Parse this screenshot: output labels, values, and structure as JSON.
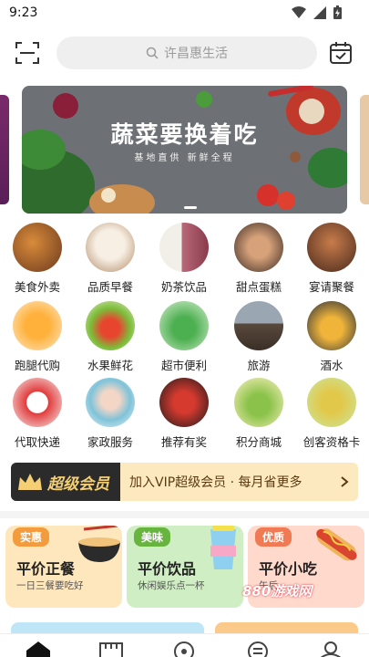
{
  "status_bar": {
    "time": "9:23"
  },
  "header": {
    "search_placeholder": "许昌惠生活"
  },
  "banner": {
    "title": "蔬菜要换着吃",
    "subtitle": "基地直供 新鲜全程"
  },
  "categories": [
    {
      "label": "美食外卖"
    },
    {
      "label": "品质早餐"
    },
    {
      "label": "奶茶饮品"
    },
    {
      "label": "甜点蛋糕"
    },
    {
      "label": "宴请聚餐"
    },
    {
      "label": "跑腿代购"
    },
    {
      "label": "水果鲜花"
    },
    {
      "label": "超市便利"
    },
    {
      "label": "旅游"
    },
    {
      "label": "酒水"
    },
    {
      "label": "代取快递"
    },
    {
      "label": "家政服务"
    },
    {
      "label": "推荐有奖"
    },
    {
      "label": "积分商城"
    },
    {
      "label": "创客资格卡"
    }
  ],
  "vip": {
    "badge": "超级会员",
    "text": "加入VIP超级会员 · 每月省更多"
  },
  "promos": [
    {
      "tag": "实惠",
      "title": "平价正餐",
      "sub": "一日三餐要吃好"
    },
    {
      "tag": "美味",
      "title": "平价饮品",
      "sub": "休闲娱乐点一杯"
    },
    {
      "tag": "优质",
      "title": "平价小吃",
      "sub": "午后"
    }
  ],
  "watermark": "880游戏网",
  "colors": {
    "accent": "#f39c3d",
    "vip_gold": "#f4cf73",
    "promo1": "#ffe7bd",
    "promo2": "#cfeec3",
    "promo3": "#ffd9cc"
  }
}
